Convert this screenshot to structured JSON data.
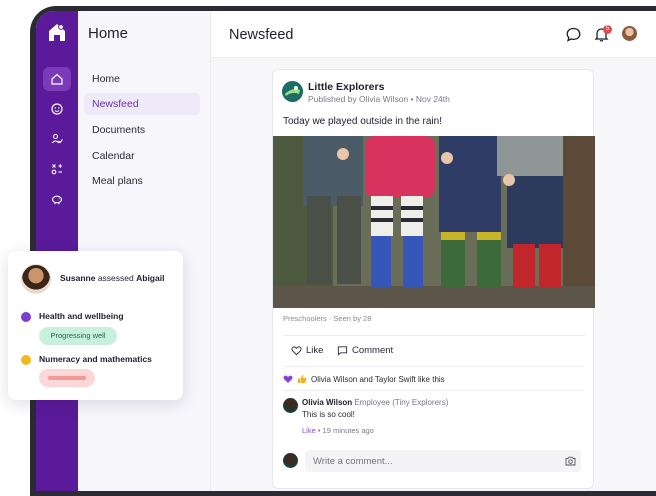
{
  "colors": {
    "brand": "#5a1a9a",
    "accent": "#6a2fb0",
    "health_dot": "#7e3bd0",
    "numeracy_dot": "#f2b81f",
    "progress_pill_bg": "#c8f0dc",
    "progress_pill_text": "#1f6a49",
    "pending_pill_bg": "#fbd7d7",
    "pending_bar": "#f29a9a",
    "notification": "#e5484d"
  },
  "rail": {
    "icons": [
      "home-icon",
      "smiley-icon",
      "person-check-icon",
      "shapes-icon",
      "piggy-bank-icon"
    ]
  },
  "sidebar": {
    "title": "Home",
    "items": [
      {
        "label": "Home",
        "active": false
      },
      {
        "label": "Newsfeed",
        "active": true
      },
      {
        "label": "Documents",
        "active": false
      },
      {
        "label": "Calendar",
        "active": false
      },
      {
        "label": "Meal plans",
        "active": false
      }
    ]
  },
  "header": {
    "title": "Newsfeed",
    "notification_count": "5"
  },
  "post": {
    "org_name": "Little Explorers",
    "meta": "Published by Olivia Wilson • Nov 24th",
    "text": "Today we played outside in the rain!",
    "tags": "Preschoolers  ·  Seen by 28",
    "like_label": "Like",
    "comment_label": "Comment",
    "likes_text": "Olivia Wilson and Taylor Swift like this",
    "comment": {
      "author": "Olivia Wilson",
      "role": "Employee (Tiny Explorers)",
      "text": "This is so cool!",
      "like_label": "Like",
      "time": " • 19 minutes ago"
    },
    "write_placeholder": "Write a comment..."
  },
  "assessment": {
    "assessor": "Susanne",
    "verb": "assessed",
    "child": "Abigail",
    "areas": [
      {
        "label": "Health and wellbeing",
        "status": "Progressing well"
      },
      {
        "label": "Numeracy and mathematics",
        "status": ""
      }
    ]
  }
}
